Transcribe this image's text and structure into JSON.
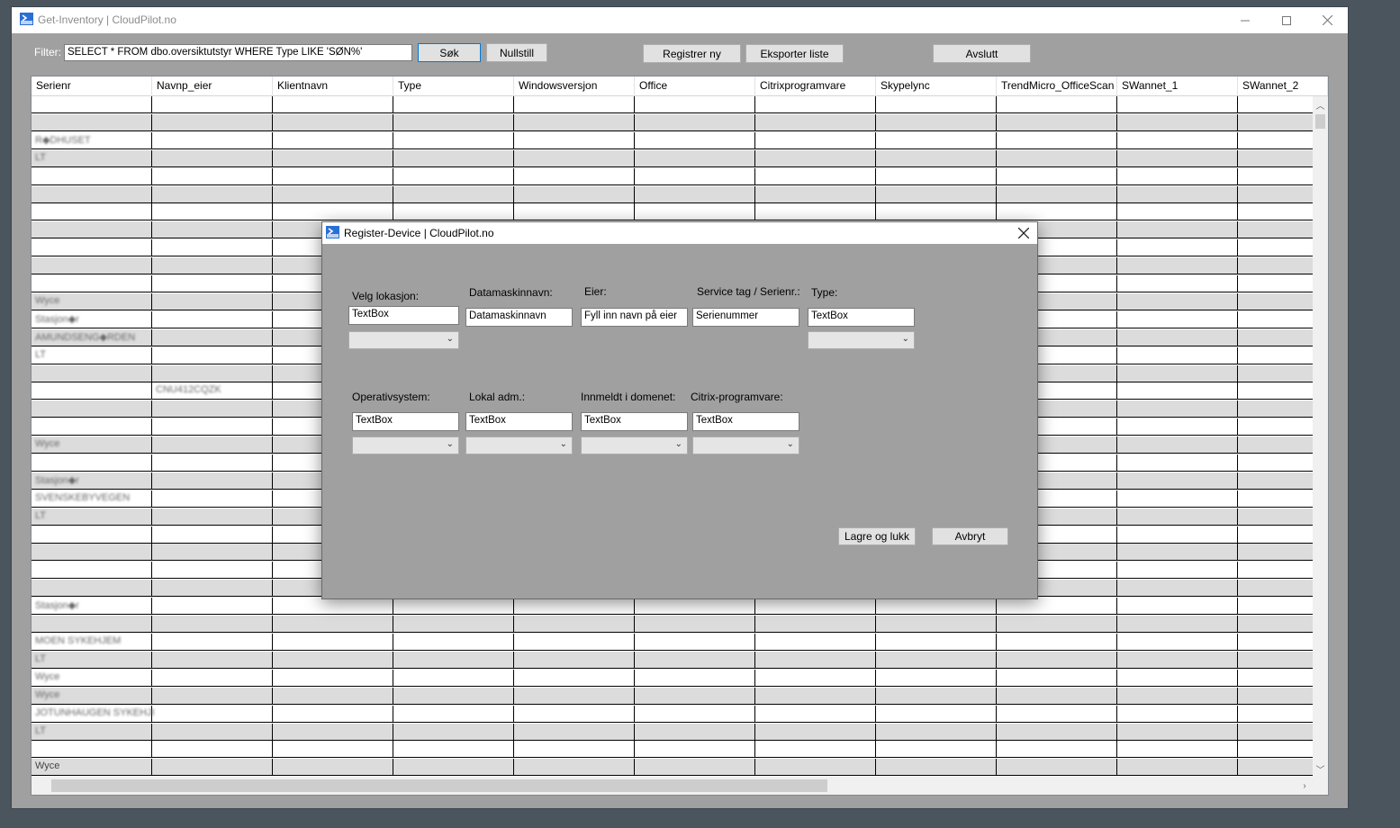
{
  "main_window": {
    "title": "Get-Inventory | CloudPilot.no"
  },
  "toolbar": {
    "filter_label": "Filter:",
    "filter_value": "SELECT * FROM dbo.oversiktutstyr WHERE Type LIKE 'SØN%'",
    "search_label": "Søk",
    "reset_label": "Nullstill",
    "register_label": "Registrer ny",
    "export_label": "Eksporter liste",
    "exit_label": "Avslutt"
  },
  "grid": {
    "columns": [
      "Serienr",
      "Navnp_eier",
      "Klientnavn",
      "Type",
      "Windowsversjon",
      "Office",
      "Citrixprogramvare",
      "Skypelync",
      "TrendMicro_OfficeScan",
      "SWannet_1",
      "SWannet_2"
    ],
    "rows": [
      {
        "serienr": "",
        "navn": ""
      },
      {
        "serienr": "",
        "navn": ""
      },
      {
        "serienr": "R◆DHUSET",
        "navn": ""
      },
      {
        "serienr": "LT",
        "navn": ""
      },
      {
        "serienr": "",
        "navn": ""
      },
      {
        "serienr": "",
        "navn": ""
      },
      {
        "serienr": "",
        "navn": ""
      },
      {
        "serienr": "",
        "navn": ""
      },
      {
        "serienr": "",
        "navn": ""
      },
      {
        "serienr": "",
        "navn": ""
      },
      {
        "serienr": "",
        "navn": ""
      },
      {
        "serienr": "Wyce",
        "navn": ""
      },
      {
        "serienr": "Stasjon◆r",
        "navn": ""
      },
      {
        "serienr": "AMUNDSENG◆RDEN",
        "navn": ""
      },
      {
        "serienr": "LT",
        "navn": ""
      },
      {
        "serienr": "",
        "navn": ""
      },
      {
        "serienr": "",
        "navn": "CNU412CQZK"
      },
      {
        "serienr": "",
        "navn": ""
      },
      {
        "serienr": "",
        "navn": ""
      },
      {
        "serienr": "Wyce",
        "navn": ""
      },
      {
        "serienr": "",
        "navn": ""
      },
      {
        "serienr": "Stasjon◆r",
        "navn": ""
      },
      {
        "serienr": "SVENSKEBYVEGEN",
        "navn": ""
      },
      {
        "serienr": "LT",
        "navn": ""
      },
      {
        "serienr": "",
        "navn": ""
      },
      {
        "serienr": "",
        "navn": ""
      },
      {
        "serienr": "",
        "navn": ""
      },
      {
        "serienr": "",
        "navn": ""
      },
      {
        "serienr": "Stasjon◆r",
        "navn": ""
      },
      {
        "serienr": "",
        "navn": ""
      },
      {
        "serienr": "MOEN SYKEHJEM",
        "navn": ""
      },
      {
        "serienr": "LT",
        "navn": ""
      },
      {
        "serienr": "Wyce",
        "navn": ""
      },
      {
        "serienr": "Wyce",
        "navn": ""
      },
      {
        "serienr": "JOTUNHAUGEN SYKEHJI",
        "navn": ""
      },
      {
        "serienr": "LT",
        "navn": ""
      },
      {
        "serienr": "",
        "navn": ""
      },
      {
        "serienr": "Wyce",
        "navn": ""
      }
    ]
  },
  "dialog": {
    "title": "Register-Device | CloudPilot.no",
    "lokasjon_label": "Velg lokasjon:",
    "lokasjon_value": "TextBox",
    "datamaskin_label": "Datamaskinnavn:",
    "datamaskin_value": "Datamaskinnavn",
    "eier_label": "Eier:",
    "eier_value": "Fyll inn navn på eier",
    "servicetag_label": "Service tag / Serienr.:",
    "servicetag_value": "Serienummer",
    "type_label": "Type:",
    "type_value": "TextBox",
    "os_label": "Operativsystem:",
    "os_value": "TextBox",
    "lokal_label": "Lokal adm.:",
    "lokal_value": "TextBox",
    "domene_label": "Innmeldt i domenet:",
    "domene_value": "TextBox",
    "citrix_label": "Citrix-programvare:",
    "citrix_value": "TextBox",
    "save_label": "Lagre og lukk",
    "cancel_label": "Avbryt"
  }
}
